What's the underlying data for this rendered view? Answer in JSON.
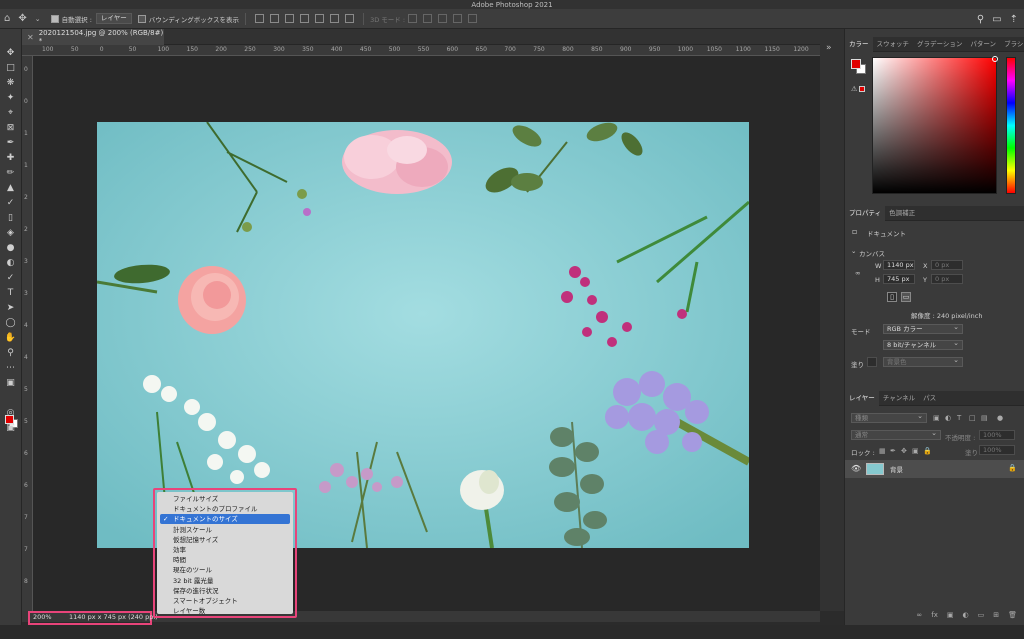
{
  "window": {
    "title": "Adobe Photoshop 2021"
  },
  "options_bar": {
    "auto_select_label": "自動選択 :",
    "auto_select_value": "レイヤー",
    "show_bounding_box_label": "バウンディングボックスを表示",
    "three_d_mode_label": "3D モード :"
  },
  "document": {
    "tab_title": "2020121504.jpg @ 200% (RGB/8#) *"
  },
  "rulers": {
    "top": [
      "100",
      "50",
      "0",
      "50",
      "100",
      "150",
      "200",
      "250",
      "300",
      "350",
      "400",
      "450",
      "500",
      "550",
      "600",
      "650",
      "700",
      "750",
      "800",
      "850",
      "900",
      "950",
      "1000",
      "1050",
      "1100",
      "1150",
      "1200"
    ],
    "left": [
      "0",
      "0",
      "1",
      "1",
      "2",
      "2",
      "3",
      "3",
      "4",
      "4",
      "5",
      "5",
      "6",
      "6",
      "7",
      "7",
      "8"
    ]
  },
  "status_bar": {
    "zoom": "200%",
    "doc_size": "1140 px x 745 px (240 ppi)"
  },
  "status_menu": {
    "items": [
      {
        "label": "ファイルサイズ",
        "selected": false
      },
      {
        "label": "ドキュメントのプロファイル",
        "selected": false
      },
      {
        "label": "ドキュメントのサイズ",
        "selected": true
      },
      {
        "label": "計測スケール",
        "selected": false
      },
      {
        "label": "仮想記憶サイズ",
        "selected": false
      },
      {
        "label": "効率",
        "selected": false
      },
      {
        "label": "時間",
        "selected": false
      },
      {
        "label": "現在のツール",
        "selected": false
      },
      {
        "label": "32 bit 露光量",
        "selected": false
      },
      {
        "label": "保存の進行状況",
        "selected": false
      },
      {
        "label": "スマートオブジェクト",
        "selected": false
      },
      {
        "label": "レイヤー数",
        "selected": false
      }
    ],
    "check_mark": "✓"
  },
  "color_panel": {
    "tabs": [
      "カラー",
      "スウォッチ",
      "グラデーション",
      "パターン",
      "ブラシ"
    ],
    "foreground": "#e00000",
    "background": "#ffffff"
  },
  "properties_panel": {
    "tabs": [
      "プロパティ",
      "色調補正"
    ],
    "section_document": "ドキュメント",
    "section_canvas": "カンバス",
    "w_label": "W",
    "w_value": "1140 px",
    "h_label": "H",
    "h_value": "745 px",
    "x_label": "X",
    "x_value": "0 px",
    "y_label": "Y",
    "y_value": "0 px",
    "resolution": "解像度 : 240 pixel/inch",
    "mode_label": "モード",
    "mode_value": "RGB カラー",
    "bit_value": "8 bit/チャンネル",
    "fill_label": "塗り",
    "fill_value": "背景色"
  },
  "layers_panel": {
    "tabs": [
      "レイヤー",
      "チャンネル",
      "パス"
    ],
    "filter_label": "種類",
    "blend_mode": "通常",
    "opacity_label": "不透明度 :",
    "opacity_value": "100%",
    "lock_label": "ロック :",
    "fill_label": "塗り :",
    "fill_value": "100%",
    "layer_name": "背景"
  }
}
